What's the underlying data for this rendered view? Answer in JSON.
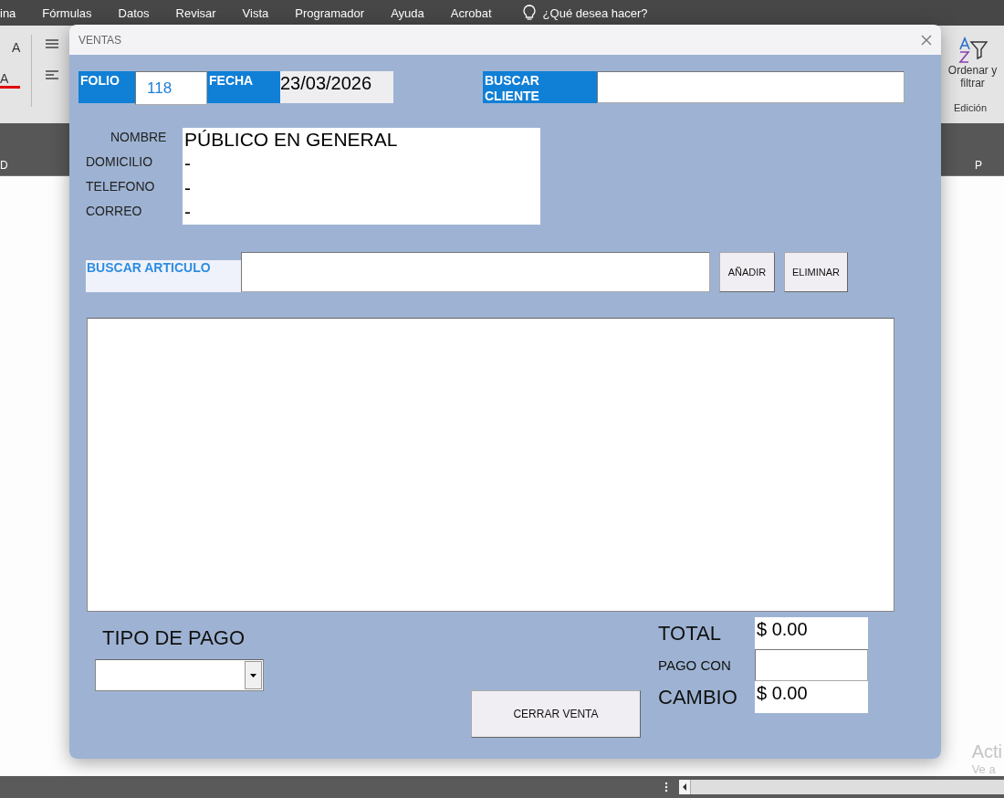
{
  "menu_bar": {
    "items": [
      "ina",
      "Fórmulas",
      "Datos",
      "Revisar",
      "Vista",
      "Programador",
      "Ayuda",
      "Acrobat"
    ],
    "tell_me": "¿Qué desea hacer?"
  },
  "ribbon": {
    "left_glyphs": [
      "A",
      "A"
    ],
    "sort_filter": {
      "label": "Ordenar y",
      "label_2": "filtrar"
    },
    "group": "Edición"
  },
  "column_headers": [
    "D",
    "P"
  ],
  "dialog": {
    "title": "VENTAS",
    "folio": {
      "label": "FOLIO",
      "value": "118"
    },
    "fecha": {
      "label": "FECHA",
      "value": "23/03/2026"
    },
    "buscar_cliente": {
      "label": "BUSCAR\nCLIENTE"
    },
    "customer": [
      {
        "label": "NOMBRE",
        "value": "PÚBLICO EN GENERAL"
      },
      {
        "label": "DOMICILIO",
        "value": "-"
      },
      {
        "label": "TELEFONO",
        "value": "-"
      },
      {
        "label": "CORREO",
        "value": "-"
      }
    ],
    "buscar_articulo": {
      "label": "BUSCAR ARTICULO"
    },
    "buttons": [
      "AÑADIR",
      "ELIMINAR"
    ],
    "tipo_de_pago": {
      "label": "TIPO DE PAGO"
    },
    "cerrar_venta": "CERRAR VENTA",
    "totals": [
      {
        "kind": "big",
        "label": "TOTAL",
        "value": "$ 0.00"
      },
      {
        "kind": "input",
        "label": "PAGO CON"
      },
      {
        "kind": "big",
        "label": "CAMBIO",
        "value": "$ 0.00"
      }
    ]
  },
  "activation_notice": [
    "Acti",
    "Ve a"
  ]
}
